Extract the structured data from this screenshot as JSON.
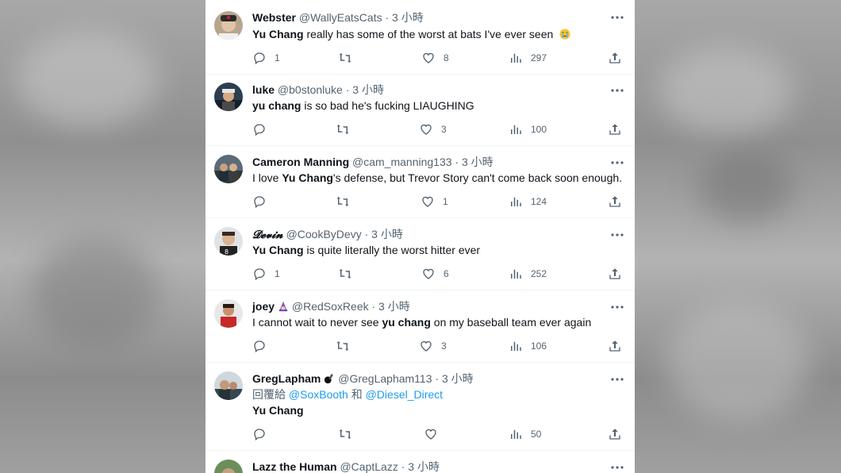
{
  "tweets": [
    {
      "name": "Webster",
      "handle": "@WallyEatsCats",
      "time": "· 3 小時",
      "text": [
        {
          "b": "Yu Chang"
        },
        {
          "t": " really has some of the worst at bats I've ever seen "
        }
      ],
      "emoji": "face-holding-back-tears-icon",
      "reply": "1",
      "retweet": "",
      "like": "8",
      "views": "297"
    },
    {
      "name": "luke",
      "handle": "@b0stonluke",
      "time": "· 3 小時",
      "text": [
        {
          "b": "yu chang"
        },
        {
          "t": " is so bad he's fucking LIAUGHING"
        }
      ],
      "reply": "",
      "retweet": "",
      "like": "3",
      "views": "100"
    },
    {
      "name": "Cameron Manning",
      "handle": "@cam_manning133",
      "time": "· 3 小時",
      "text": [
        {
          "t": "I love "
        },
        {
          "b": "Yu Chang"
        },
        {
          "t": "'s defense, but Trevor Story can't come back soon enough."
        }
      ],
      "reply": "",
      "retweet": "",
      "like": "1",
      "views": "124"
    },
    {
      "name": "𝓓𝓮𝓿𝓲𝓷",
      "handle": "@CookByDevy",
      "time": "· 3 小時",
      "text": [
        {
          "b": "Yu Chang"
        },
        {
          "t": " is quite literally the worst hitter ever"
        }
      ],
      "reply": "1",
      "retweet": "",
      "like": "6",
      "views": "252"
    },
    {
      "name": "joey",
      "handle": "@RedSoxReek",
      "time": "· 3 小時",
      "text": [
        {
          "t": "I cannot wait to never see "
        },
        {
          "b": "yu chang"
        },
        {
          "t": " on my baseball team ever again"
        }
      ],
      "reply": "",
      "retweet": "",
      "like": "3",
      "views": "106"
    },
    {
      "name": "GregLapham",
      "handle": "@GregLapham113",
      "time": "· 3 小時",
      "reply_to_prefix": "回覆給 ",
      "reply_to_1": "@SoxBooth",
      "reply_to_and": " 和 ",
      "reply_to_2": "@Diesel_Direct",
      "text": [
        {
          "b": "Yu Chang"
        }
      ],
      "reply": "",
      "retweet": "",
      "like": "",
      "views": "50"
    },
    {
      "name": "Lazz the Human",
      "handle": "@CaptLazz",
      "time": "· 3 小時"
    }
  ],
  "colors": {
    "text": "#0f1419",
    "secondary": "#536471",
    "link": "#1d9bf0",
    "divider": "#eff3f4"
  },
  "icons": {
    "reply": "reply-icon",
    "retweet": "retweet-icon",
    "like": "like-icon",
    "views": "views-icon",
    "share": "share-icon",
    "more": "more-icon"
  }
}
